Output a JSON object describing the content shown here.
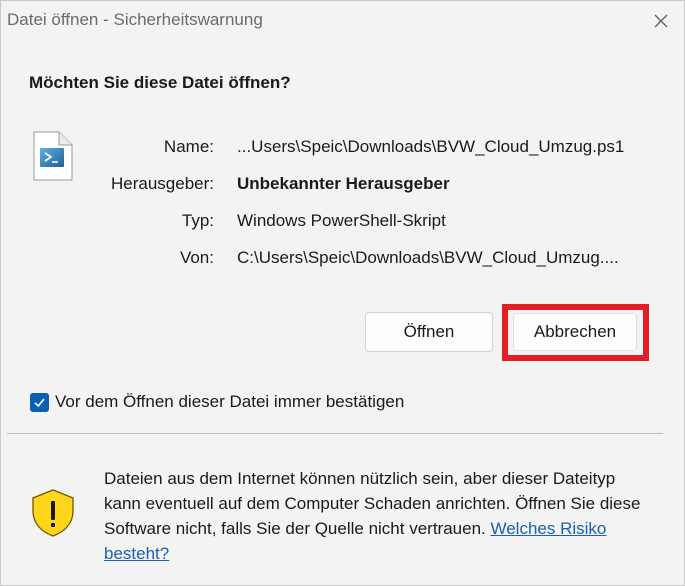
{
  "window": {
    "title": "Datei öffnen - Sicherheitswarnung",
    "close_icon": "close-icon"
  },
  "question": "Möchten Sie diese Datei öffnen?",
  "file_icon": "powershell-script-file-icon",
  "info": {
    "name_label": "Name:",
    "name_value": "...Users\\Speic\\Downloads\\BVW_Cloud_Umzug.ps1",
    "publisher_label": "Herausgeber:",
    "publisher_value": "Unbekannter Herausgeber",
    "type_label": "Typ:",
    "type_value": "Windows PowerShell-Skript",
    "from_label": "Von:",
    "from_value": "C:\\Users\\Speic\\Downloads\\BVW_Cloud_Umzug...."
  },
  "buttons": {
    "open_label": "Öffnen",
    "cancel_label": "Abbrechen"
  },
  "highlight_color": "#e41e26",
  "checkbox": {
    "checked": true,
    "label": "Vor dem Öffnen dieser Datei immer bestätigen"
  },
  "warning": {
    "icon": "shield-warning-icon",
    "text": "Dateien aus dem Internet können nützlich sein, aber dieser Dateityp kann eventuell auf dem Computer Schaden anrichten. Öffnen Sie diese Software nicht, falls Sie der Quelle nicht vertrauen. ",
    "link_text": "Welches Risiko besteht?"
  }
}
